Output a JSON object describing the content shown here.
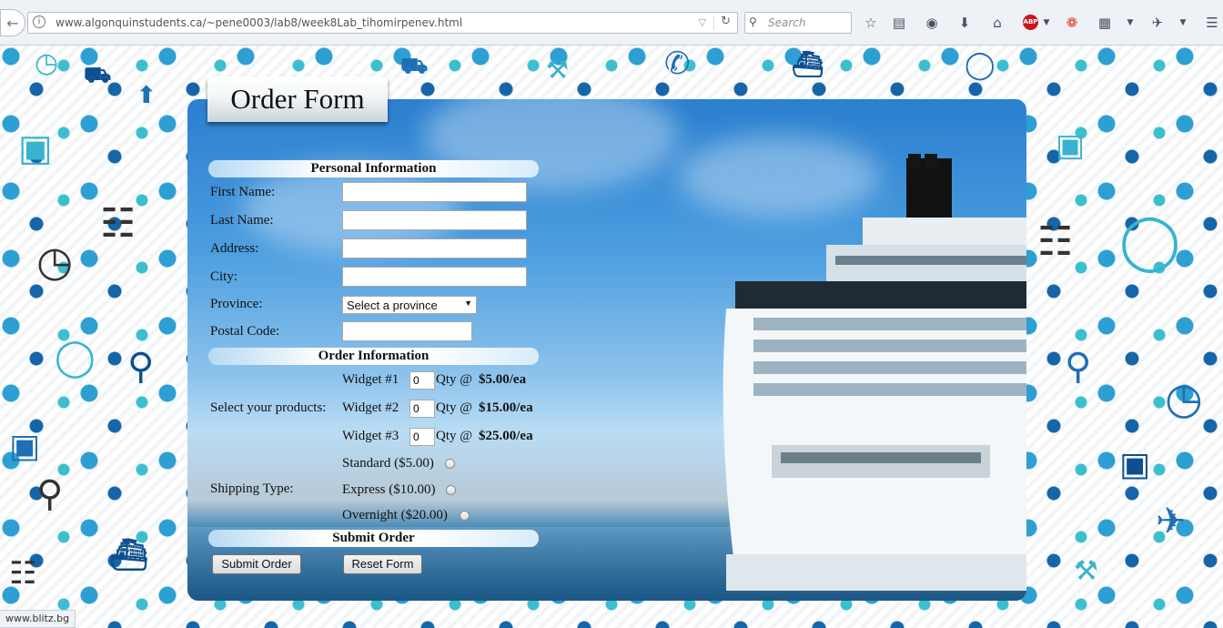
{
  "browser": {
    "url": "www.algonquinstudents.ca/~pene0003/lab8/week8Lab_tihomirpenev.html",
    "search_placeholder": "Search",
    "abp_label": "ABP",
    "status_text": "www.blitz.bg"
  },
  "form": {
    "title": "Order Form",
    "sections": {
      "personal": "Personal Information",
      "order": "Order Information",
      "submit": "Submit Order"
    },
    "fields": {
      "first_name": "First Name:",
      "last_name": "Last Name:",
      "address": "Address:",
      "city": "City:",
      "province": "Province:",
      "province_selected": "Select a province",
      "postal_code": "Postal Code:"
    },
    "products_label": "Select your products:",
    "widgets": [
      {
        "name": "Widget #1",
        "qty": "0",
        "qty_label": "Qty @",
        "price": "$5.00/ea"
      },
      {
        "name": "Widget #2",
        "qty": "0",
        "qty_label": "Qty @",
        "price": "$15.00/ea"
      },
      {
        "name": "Widget #3",
        "qty": "0",
        "qty_label": "Qty @",
        "price": "$25.00/ea"
      }
    ],
    "shipping_label": "Shipping Type:",
    "shipping_options": [
      "Standard ($5.00)",
      "Express ($10.00)",
      "Overnight ($20.00)"
    ],
    "buttons": {
      "submit": "Submit Order",
      "reset": "Reset Form"
    }
  },
  "colors": {
    "pattern_blue": "#1f6fb5",
    "pattern_teal": "#37b3cf",
    "sky_top": "#2a7fcf",
    "sea": "#23628f"
  }
}
